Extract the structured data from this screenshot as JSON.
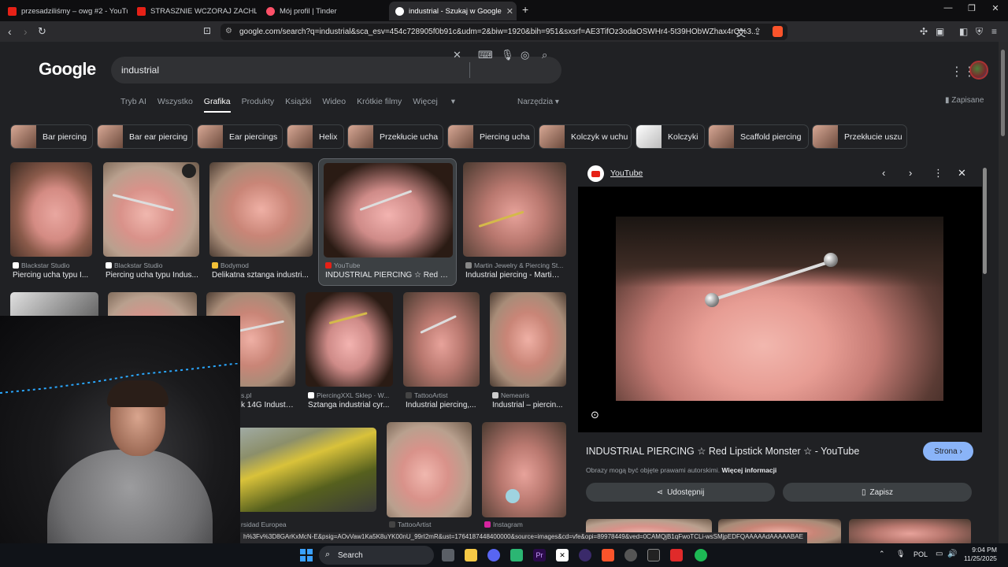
{
  "tabs": [
    {
      "title": "przesadziliśmy – owg #2 - YouTube",
      "color": "#e62117"
    },
    {
      "title": "STRASZNIE WCZORAJ ZACHLAŚMY",
      "color": "#e62117"
    },
    {
      "title": "Mój profil | Tinder",
      "color": "#fd5068"
    },
    {
      "title": "industrial - Szukaj w Google",
      "color": "#ffffff",
      "active": true
    }
  ],
  "address": {
    "url": "google.com/search?q=industrial&sca_esv=454c728905f0b91c&udm=2&biw=1920&bih=951&sxsrf=AE3TifOz3odaOSWHr4-5t39HObWZhax4rQ%3..."
  },
  "google": {
    "logo": "Google",
    "query": "industrial",
    "nav": [
      "Tryb AI",
      "Wszystko",
      "Grafika",
      "Produkty",
      "Książki",
      "Wideo",
      "Krótkie filmy",
      "Więcej"
    ],
    "nav_more_label": "Więcej",
    "tools": "Narzędzia",
    "saved": "Zapisane",
    "chips": [
      "Bar piercing",
      "Bar ear piercing",
      "Ear piercings",
      "Helix",
      "Przekłucie ucha",
      "Piercing ucha",
      "Kolczyk w uchu",
      "Kolczyki",
      "Scaffold piercing",
      "Przekłucie uszu"
    ]
  },
  "results_row1": [
    {
      "source": "Blackstar Studio",
      "title": "Piercing ucha typu I..."
    },
    {
      "source": "Blackstar Studio",
      "title": "Piercing ucha typu Indus..."
    },
    {
      "source": "Bodymod",
      "title": "Delikatna sztanga industri..."
    },
    {
      "source": "YouTube",
      "title": "INDUSTRIAL PIERCING ☆ Red Lip..."
    },
    {
      "source": "Martin Jewelry & Piercing St...",
      "title": "Industrial piercing - Martin ..."
    }
  ],
  "results_row2": [
    {
      "source": "s.pl",
      "title": "k 14G Industri..."
    },
    {
      "source": "PiercingXXL Sklep · W...",
      "title": "Sztanga industrial cyr..."
    },
    {
      "source": "TattooArtist",
      "title": "Industrial piercing,..."
    },
    {
      "source": "Nemearis",
      "title": "Industrial – piercin..."
    }
  ],
  "results_row3": [
    {
      "source": "rsidad Europea"
    },
    {
      "source": "TattooArtist"
    },
    {
      "source": "Instagram"
    }
  ],
  "panel": {
    "source": "YouTube",
    "title": "INDUSTRIAL PIERCING ☆ Red Lipstick Monster ☆ - YouTube",
    "visit": "Strona",
    "notice": "Obrazy mogą być objęte prawami autorskimi.",
    "notice_link": "Więcej informacji",
    "share": "Udostępnij",
    "save": "Zapisz"
  },
  "status_url": "h%3Fv%3D8GArKxMcN-E&psig=AOvVaw1Ka5K8uYK00nU_99rI2mR&ust=1764187448400000&source=images&cd=vfe&opi=89978449&ved=0CAMQjB1qFwoTCLi-wsSMjpEDFQAAAAAdAAAAABAE",
  "taskbar": {
    "search": "Search",
    "lang": "POL",
    "time": "9:04 PM",
    "date": "11/25/2025"
  }
}
